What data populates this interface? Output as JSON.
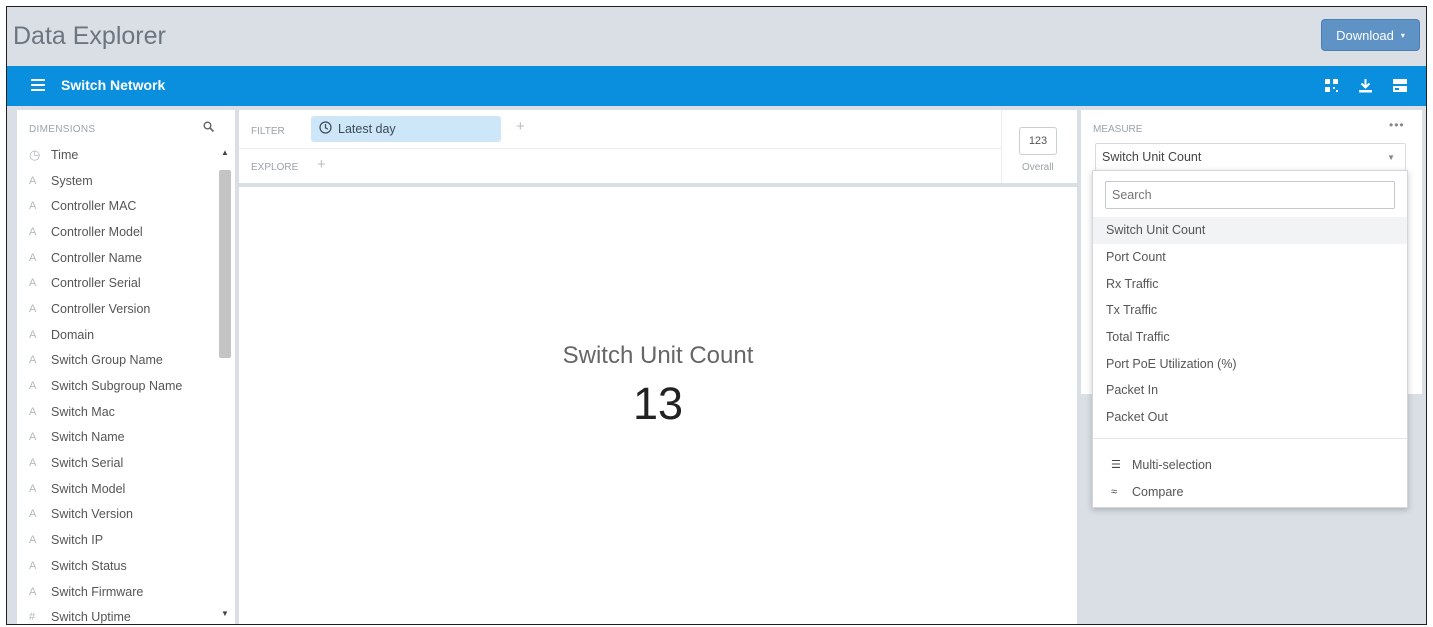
{
  "app": {
    "title": "Data Explorer"
  },
  "header": {
    "download_label": "Download",
    "download_caret": "▾"
  },
  "toolbar": {
    "network_title": "Switch Network",
    "icons": [
      "menu-icon",
      "pin-icon",
      "download-icon",
      "toggle-icon"
    ]
  },
  "dimensions": {
    "header": "DIMENSIONS",
    "items": [
      {
        "label": "Time",
        "icon": "clock-icon",
        "glyph": "◷"
      },
      {
        "label": "System",
        "icon": "string-icon",
        "glyph": "A"
      },
      {
        "label": "Controller MAC",
        "icon": "string-icon",
        "glyph": "A"
      },
      {
        "label": "Controller Model",
        "icon": "string-icon",
        "glyph": "A"
      },
      {
        "label": "Controller Name",
        "icon": "string-icon",
        "glyph": "A"
      },
      {
        "label": "Controller Serial",
        "icon": "string-icon",
        "glyph": "A"
      },
      {
        "label": "Controller Version",
        "icon": "string-icon",
        "glyph": "A"
      },
      {
        "label": "Domain",
        "icon": "string-icon",
        "glyph": "A"
      },
      {
        "label": "Switch Group Name",
        "icon": "string-icon",
        "glyph": "A"
      },
      {
        "label": "Switch Subgroup Name",
        "icon": "string-icon",
        "glyph": "A"
      },
      {
        "label": "Switch Mac",
        "icon": "string-icon",
        "glyph": "A"
      },
      {
        "label": "Switch Name",
        "icon": "string-icon",
        "glyph": "A"
      },
      {
        "label": "Switch Serial",
        "icon": "string-icon",
        "glyph": "A"
      },
      {
        "label": "Switch Model",
        "icon": "string-icon",
        "glyph": "A"
      },
      {
        "label": "Switch Version",
        "icon": "string-icon",
        "glyph": "A"
      },
      {
        "label": "Switch IP",
        "icon": "string-icon",
        "glyph": "A"
      },
      {
        "label": "Switch Status",
        "icon": "string-icon",
        "glyph": "A"
      },
      {
        "label": "Switch Firmware",
        "icon": "string-icon",
        "glyph": "A"
      },
      {
        "label": "Switch Uptime",
        "icon": "number-icon",
        "glyph": "#"
      }
    ]
  },
  "filter": {
    "label": "FILTER",
    "pill": "Latest day",
    "add": "+",
    "explore_label": "EXPLORE",
    "explore_add": "+"
  },
  "overall": {
    "value": "123",
    "label": "Overall"
  },
  "metric": {
    "name": "Switch Unit Count",
    "value": "13"
  },
  "measure": {
    "label": "MEASURE",
    "more": "•••",
    "selected": "Switch Unit Count",
    "caret": "▼"
  },
  "dropdown": {
    "search_placeholder": "Search",
    "options": [
      "Switch Unit Count",
      "Port Count",
      "Rx Traffic",
      "Tx Traffic",
      "Total Traffic",
      "Port PoE Utilization (%)",
      "Packet In",
      "Packet Out"
    ],
    "actions": [
      {
        "label": "Multi-selection",
        "glyph": "☰"
      },
      {
        "label": "Compare",
        "glyph": "≈"
      }
    ]
  },
  "colors": {
    "toolbar_blue": "#0a8fde",
    "download_button": "#5f93c5",
    "filter_pill": "#cde7f8",
    "background": "#d9dfe5"
  }
}
